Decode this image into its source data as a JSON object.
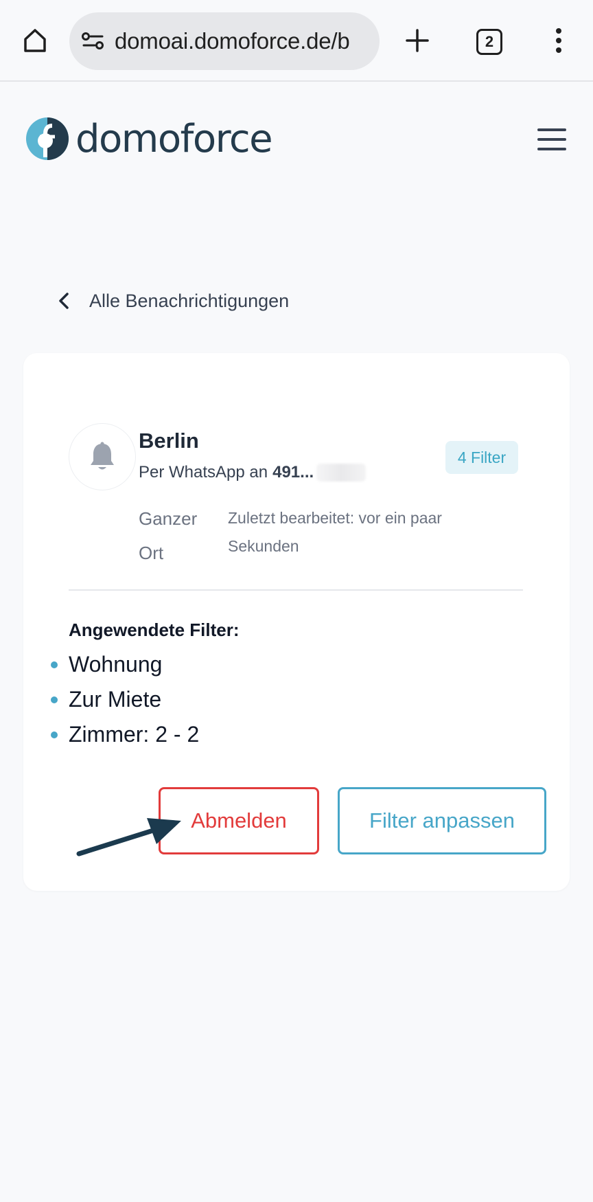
{
  "browser": {
    "url": "domoai.domoforce.de/b",
    "tab_count": "2",
    "icons": [
      "home-icon",
      "site-settings-icon",
      "new-tab-icon",
      "tab-switcher-icon",
      "more-menu-icon"
    ]
  },
  "header": {
    "logo_text": "domoforce",
    "menu_icon": "hamburger-menu-icon"
  },
  "back": {
    "label": "Alle Benachrichtigungen"
  },
  "alert": {
    "title": "Berlin",
    "channel_prefix": "Per WhatsApp an",
    "phone_visible": "491...",
    "badge": "4 Filter",
    "scope": "Ganzer Ort",
    "edited": "Zuletzt bearbeitet: vor ein paar Sekunden",
    "filters_title": "Angewendete Filter:",
    "filters": [
      "Wohnung",
      "Zur Miete",
      "Zimmer: 2 - 2"
    ],
    "unsubscribe_label": "Abmelden",
    "edit_label": "Filter anpassen"
  },
  "colors": {
    "brand_teal": "#47a6c8",
    "danger_red": "#e23b3b",
    "logo_dark": "#243b4c",
    "annotation_arrow": "#1b3a4e"
  }
}
